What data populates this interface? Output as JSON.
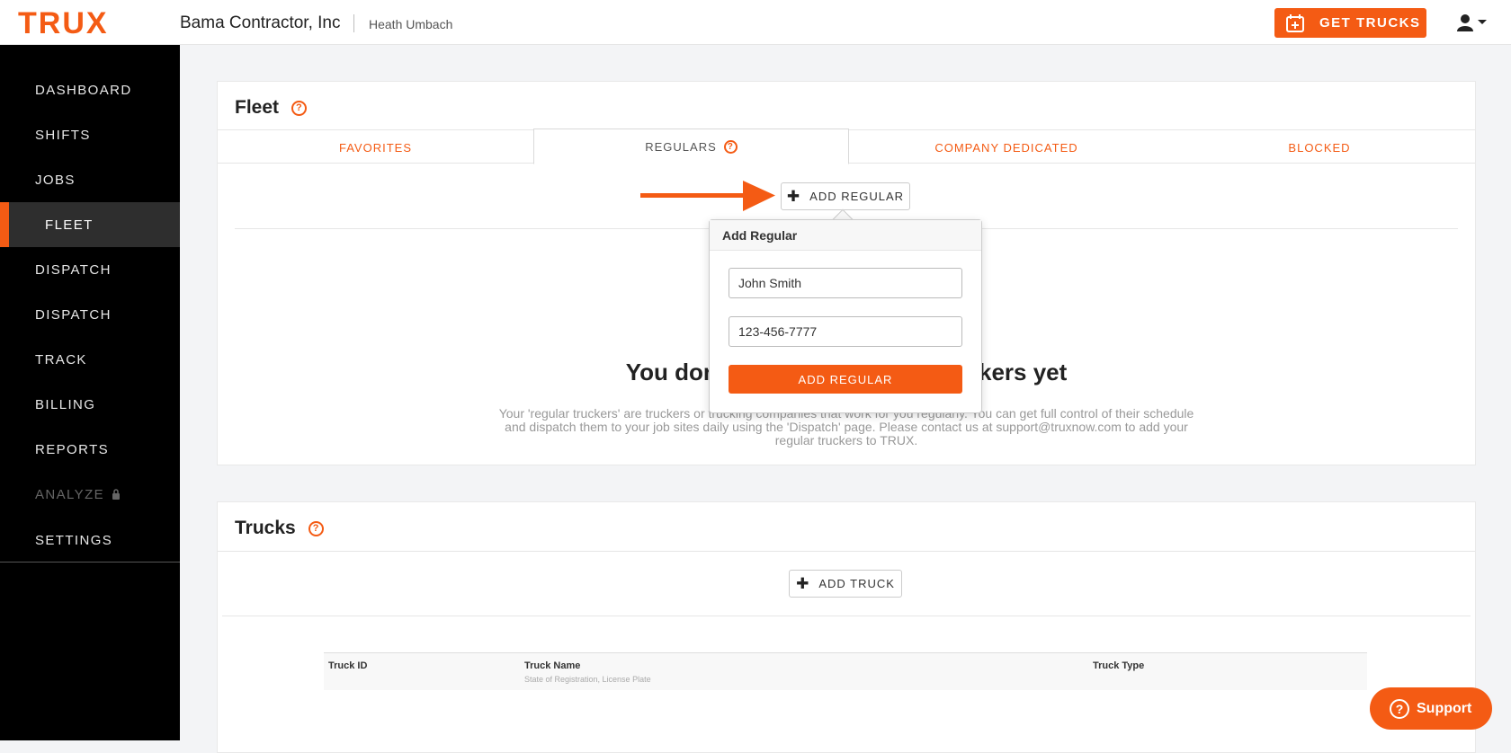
{
  "header": {
    "logo_text": "TRUX",
    "company": "Bama Contractor, Inc",
    "user": "Heath Umbach",
    "get_trucks_label": "GET TRUCKS",
    "brand_color": "#f45b14"
  },
  "sidebar": {
    "items": [
      {
        "label": "DASHBOARD"
      },
      {
        "label": "SHIFTS"
      },
      {
        "label": "JOBS"
      },
      {
        "label": "FLEET"
      },
      {
        "label": "DISPATCH"
      },
      {
        "label": "DISPATCH"
      },
      {
        "label": "TRACK"
      },
      {
        "label": "BILLING"
      },
      {
        "label": "REPORTS"
      },
      {
        "label": "ANALYZE"
      },
      {
        "label": "SETTINGS"
      }
    ],
    "active": "FLEET"
  },
  "fleet": {
    "title": "Fleet",
    "tabs": [
      {
        "label": "FAVORITES"
      },
      {
        "label": "REGULARS"
      },
      {
        "label": "COMPANY DEDICATED"
      },
      {
        "label": "BLOCKED"
      }
    ],
    "add_regular_label": "ADD REGULAR",
    "empty_title_left": "You dor",
    "empty_title_right": "kers yet",
    "empty_desc_1": "Your 'regular truckers' are truckers or trucking companies that work for you regularly. You can get full control of their schedule",
    "empty_desc_2": "and dispatch them to your job sites daily using the 'Dispatch' page. Please contact us at support@truxnow.com to add your",
    "empty_desc_3": "regular truckers to TRUX."
  },
  "popover": {
    "title": "Add Regular",
    "name_value": "John Smith",
    "phone_value": "123-456-7777",
    "submit_label": "ADD REGULAR"
  },
  "trucks": {
    "title": "Trucks",
    "add_truck_label": "ADD TRUCK",
    "columns": [
      {
        "label": "Truck ID",
        "sub": ""
      },
      {
        "label": "Truck Name",
        "sub": "State of Registration, License Plate"
      },
      {
        "label": "Truck Type",
        "sub": ""
      }
    ]
  },
  "support": {
    "label": "Support"
  }
}
